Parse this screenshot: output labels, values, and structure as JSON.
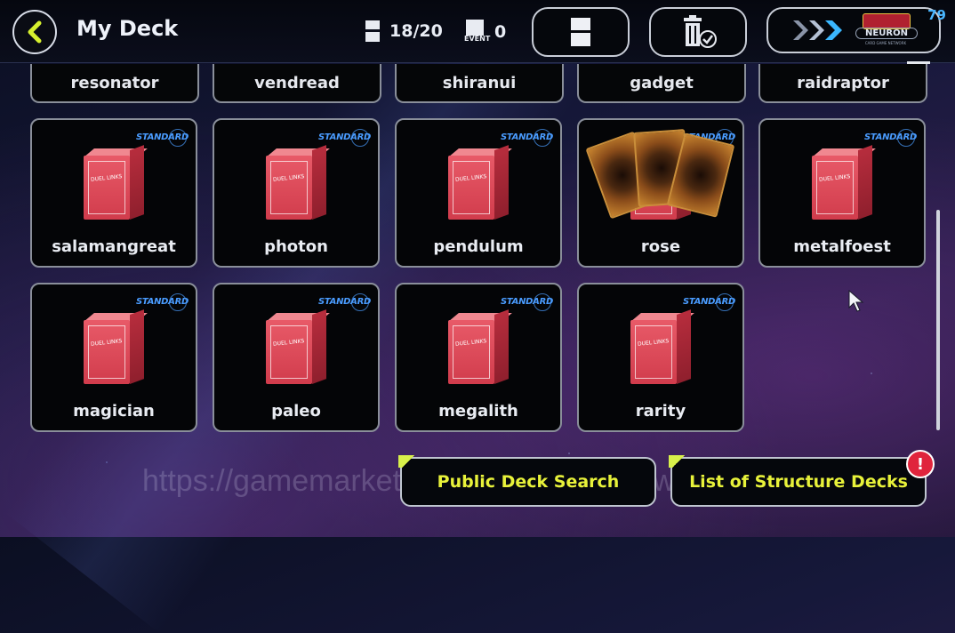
{
  "header": {
    "title": "My Deck",
    "deck_count": "18/20",
    "event_label": "EVENT",
    "event_count": "0",
    "corner_number": "79",
    "logo_lines": [
      "NEURON",
      "CARD GAME NETWORK"
    ]
  },
  "top_row": [
    "resonator",
    "vendread",
    "shiranui",
    "gadget",
    "raidraptor"
  ],
  "badge_text": "STANDARD",
  "box_text": "DUEL LINKS",
  "decks_row1": [
    "salamangreat",
    "photon",
    "pendulum",
    "rose",
    "metalfoest"
  ],
  "decks_row2": [
    "magician",
    "paleo",
    "megalith",
    "rarity"
  ],
  "buttons": {
    "public_search": "Public Deck Search",
    "structure_decks": "List of Structure Decks",
    "alert": "!"
  },
  "watermark": "https://gamemarket.gg/seller/GameNews",
  "colors": {
    "accent": "#e8f23a",
    "badge": "#4a9cff",
    "deck_box": "#d13c4c",
    "alert": "#e0243c"
  }
}
